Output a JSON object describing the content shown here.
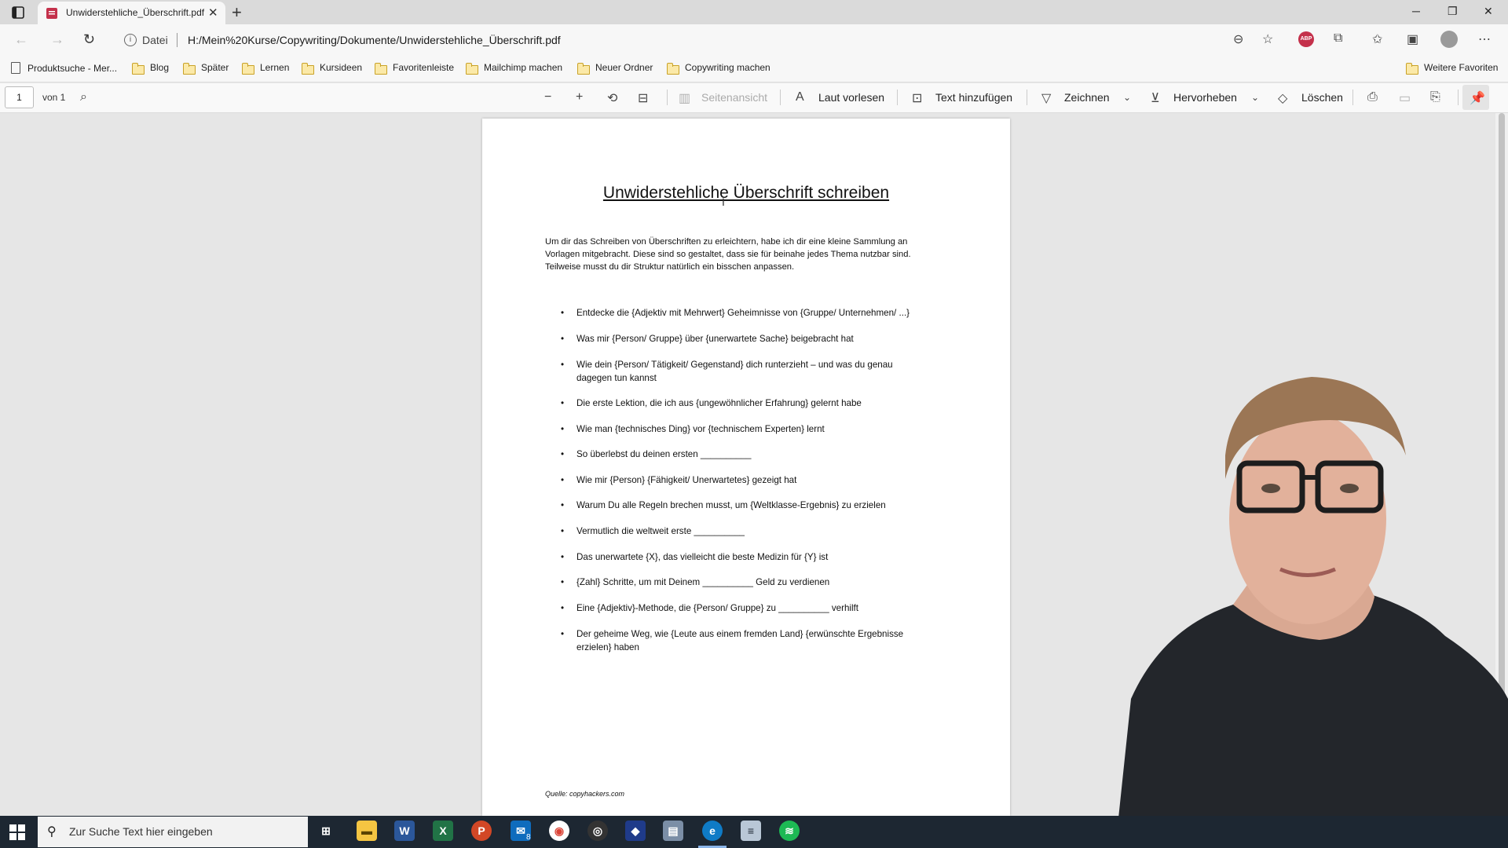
{
  "browser": {
    "tab_title": "Unwiderstehliche_Überschrift.pdf",
    "url_label": "Datei",
    "url": "H:/Mein%20Kurse/Copywriting/Dokumente/Unwiderstehliche_Überschrift.pdf",
    "abp_label": "ABP"
  },
  "favorites": {
    "items": [
      {
        "label": "Produktsuche - Mer...",
        "icon": "page-icon"
      },
      {
        "label": "Blog",
        "icon": "folder-icon"
      },
      {
        "label": "Später",
        "icon": "folder-icon"
      },
      {
        "label": "Lernen",
        "icon": "folder-icon"
      },
      {
        "label": "Kursideen",
        "icon": "folder-icon"
      },
      {
        "label": "Favoritenleiste",
        "icon": "folder-icon"
      },
      {
        "label": "Mailchimp machen",
        "icon": "folder-icon"
      },
      {
        "label": "Neuer Ordner",
        "icon": "folder-icon"
      },
      {
        "label": "Copywriting machen",
        "icon": "folder-icon"
      }
    ],
    "more": "Weitere Favoriten"
  },
  "pdf_toolbar": {
    "page_number": "1",
    "page_of": "von 1",
    "seitenansicht": "Seitenansicht",
    "laut_vorlesen": "Laut vorlesen",
    "text_hinzufuegen": "Text hinzufügen",
    "zeichnen": "Zeichnen",
    "hervorheben": "Hervorheben",
    "loeschen": "Löschen"
  },
  "document": {
    "title": "Unwiderstehliche Überschrift schreiben",
    "intro": [
      "Um dir das Schreiben von Überschriften zu erleichtern, habe ich dir eine kleine Sammlung an",
      "Vorlagen mitgebracht. Diese sind so gestaltet, dass sie für beinahe jedes Thema nutzbar sind.",
      "Teilweise musst du dir Struktur natürlich ein bisschen anpassen."
    ],
    "bullets": [
      [
        "Entdecke die {Adjektiv mit Mehrwert} Geheimnisse von {Gruppe/ Unternehmen/ ...}"
      ],
      [
        "Was mir {Person/ Gruppe} über {unerwartete Sache} beigebracht hat"
      ],
      [
        "Wie dein {Person/ Tätigkeit/ Gegenstand} dich runterzieht – und was du genau",
        "dagegen tun kannst"
      ],
      [
        "Die erste Lektion, die ich aus {ungewöhnlicher Erfahrung} gelernt habe"
      ],
      [
        "Wie man {technisches Ding} vor {technischem Experten} lernt"
      ],
      [
        "So überlebst du deinen ersten __________"
      ],
      [
        "Wie mir {Person} {Fähigkeit/ Unerwartetes} gezeigt hat"
      ],
      [
        "Warum Du alle Regeln brechen musst, um {Weltklasse-Ergebnis} zu erzielen"
      ],
      [
        "Vermutlich die weltweit erste __________"
      ],
      [
        "Das unerwartete {X}, das vielleicht die beste Medizin für {Y} ist"
      ],
      [
        "{Zahl} Schritte, um mit Deinem __________ Geld zu verdienen"
      ],
      [
        "Eine {Adjektiv}-Methode, die {Person/ Gruppe} zu __________ verhilft"
      ],
      [
        "Der geheime Weg, wie {Leute aus einem fremden Land} {erwünschte Ergebnisse",
        "erzielen} haben"
      ]
    ],
    "source": "Quelle: copyhackers.com"
  },
  "taskbar": {
    "search_placeholder": "Zur Suche Text hier eingeben",
    "mail_badge": "8",
    "apps": [
      "task-view",
      "file-explorer",
      "word",
      "excel",
      "powerpoint",
      "mail",
      "chrome",
      "obs",
      "app-blue",
      "app-window",
      "edge",
      "notepad",
      "spotify"
    ]
  },
  "colors": {
    "accent_edge": "#0f7bc6",
    "word": "#2b579a",
    "excel": "#217346",
    "powerpoint": "#d24726",
    "spotify": "#1db954"
  }
}
